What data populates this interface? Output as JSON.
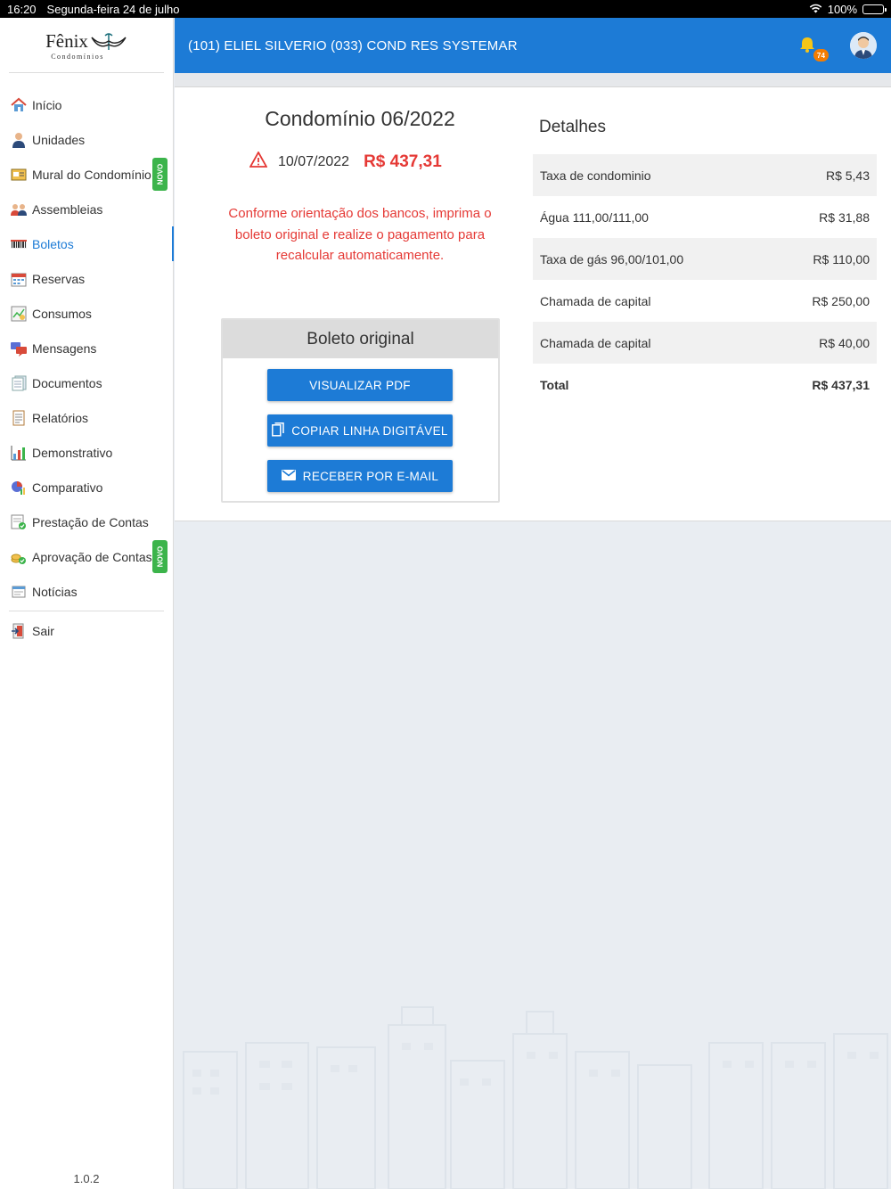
{
  "status_bar": {
    "time": "16:20",
    "date": "Segunda-feira 24 de julho",
    "battery": "100%"
  },
  "logo": {
    "name": "Fênix",
    "sub": "Condomínios"
  },
  "sidebar": {
    "items": [
      {
        "label": "Início",
        "icon": "house-icon"
      },
      {
        "label": "Unidades",
        "icon": "person-icon"
      },
      {
        "label": "Mural do Condomínio",
        "icon": "board-icon",
        "badge": "NOVO"
      },
      {
        "label": "Assembleias",
        "icon": "people-icon"
      },
      {
        "label": "Boletos",
        "icon": "barcode-icon",
        "active": true
      },
      {
        "label": "Reservas",
        "icon": "calendar-icon"
      },
      {
        "label": "Consumos",
        "icon": "meter-icon"
      },
      {
        "label": "Mensagens",
        "icon": "chat-icon"
      },
      {
        "label": "Documentos",
        "icon": "document-icon"
      },
      {
        "label": "Relatórios",
        "icon": "report-icon"
      },
      {
        "label": "Demonstrativo",
        "icon": "bar-chart-icon"
      },
      {
        "label": "Comparativo",
        "icon": "pie-chart-icon"
      },
      {
        "label": "Prestação de Contas",
        "icon": "accounts-icon"
      },
      {
        "label": "Aprovação de Contas",
        "icon": "coins-icon",
        "badge": "NOVO"
      },
      {
        "label": "Notícias",
        "icon": "news-icon"
      }
    ],
    "logout": "Sair",
    "version": "1.0.2"
  },
  "header": {
    "title": "(101) ELIEL SILVERIO  (033) COND RES SYSTEMAR",
    "notification_count": "74"
  },
  "boleto": {
    "title": "Condomínio 06/2022",
    "due_date": "10/07/2022",
    "amount": "R$ 437,31",
    "warning": "Conforme orientação dos bancos, imprima o boleto original e realize o pagamento para recalcular automaticamente.",
    "box_title": "Boleto original",
    "btn_pdf": "VISUALIZAR PDF",
    "btn_copy": "COPIAR LINHA DIGITÁVEL",
    "btn_email": "RECEBER POR E-MAIL"
  },
  "details": {
    "title": "Detalhes",
    "rows": [
      {
        "label": "Taxa de condominio",
        "value": "R$ 5,43"
      },
      {
        "label": "Água 111,00/111,00",
        "value": "R$ 31,88"
      },
      {
        "label": "Taxa de gás 96,00/101,00",
        "value": "R$ 110,00"
      },
      {
        "label": "Chamada de capital",
        "value": "R$ 250,00"
      },
      {
        "label": "Chamada de capital",
        "value": "R$ 40,00"
      }
    ],
    "total_label": "Total",
    "total_value": "R$ 437,31"
  },
  "colors": {
    "primary": "#1d7bd6",
    "danger": "#e53935",
    "badge": "#3cb44b",
    "notify": "#f57c00"
  }
}
